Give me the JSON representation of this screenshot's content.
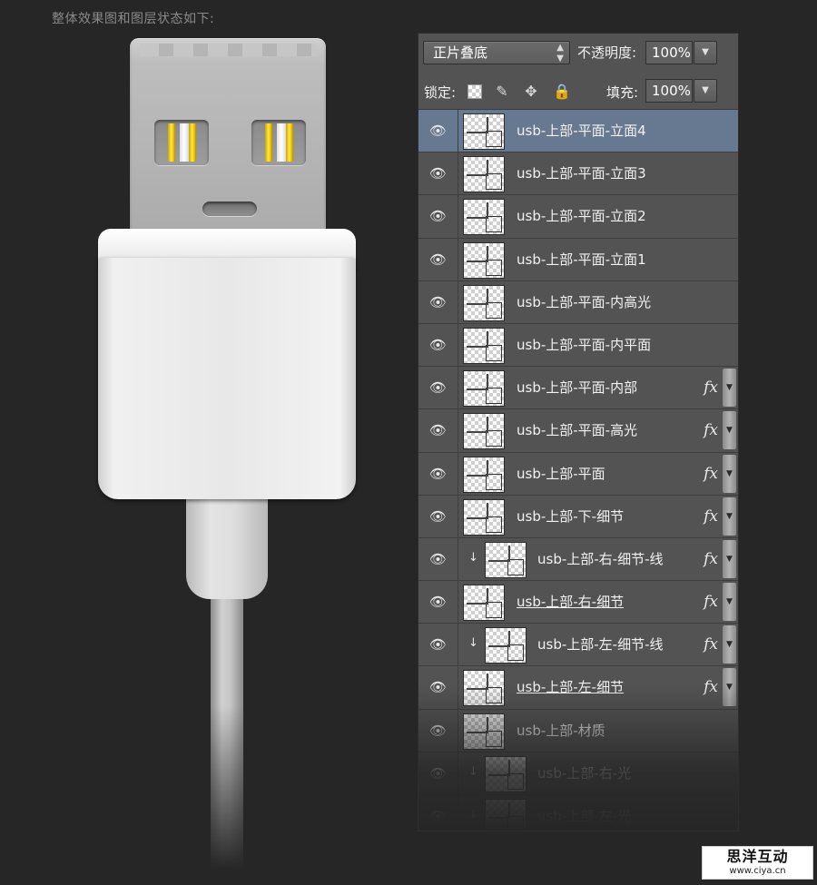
{
  "caption": "整体效果图和图层状态如下:",
  "panel": {
    "blend_mode": "正片叠底",
    "opacity_label": "不透明度:",
    "opacity_value": "100%",
    "lock_label": "锁定:",
    "fill_label": "填充:",
    "fill_value": "100%",
    "lock_icons": [
      "transparency-lock-icon",
      "brush-icon",
      "move-icon",
      "lock-icon"
    ]
  },
  "layers": [
    {
      "name": "usb-上部-平面-立面4",
      "selected": true,
      "fx": false,
      "clip": false,
      "underline": false
    },
    {
      "name": "usb-上部-平面-立面3",
      "selected": false,
      "fx": false,
      "clip": false,
      "underline": false
    },
    {
      "name": "usb-上部-平面-立面2",
      "selected": false,
      "fx": false,
      "clip": false,
      "underline": false
    },
    {
      "name": "usb-上部-平面-立面1",
      "selected": false,
      "fx": false,
      "clip": false,
      "underline": false
    },
    {
      "name": "usb-上部-平面-内高光",
      "selected": false,
      "fx": false,
      "clip": false,
      "underline": false
    },
    {
      "name": "usb-上部-平面-内平面",
      "selected": false,
      "fx": false,
      "clip": false,
      "underline": false
    },
    {
      "name": "usb-上部-平面-内部",
      "selected": false,
      "fx": true,
      "clip": false,
      "underline": false
    },
    {
      "name": "usb-上部-平面-高光",
      "selected": false,
      "fx": true,
      "clip": false,
      "underline": false
    },
    {
      "name": "usb-上部-平面",
      "selected": false,
      "fx": true,
      "clip": false,
      "underline": false
    },
    {
      "name": "usb-上部-下-细节",
      "selected": false,
      "fx": true,
      "clip": false,
      "underline": false
    },
    {
      "name": "usb-上部-右-细节-线",
      "selected": false,
      "fx": true,
      "clip": true,
      "underline": false
    },
    {
      "name": "usb-上部-右-细节",
      "selected": false,
      "fx": true,
      "clip": false,
      "underline": true
    },
    {
      "name": "usb-上部-左-细节-线",
      "selected": false,
      "fx": true,
      "clip": true,
      "underline": false
    },
    {
      "name": "usb-上部-左-细节",
      "selected": false,
      "fx": true,
      "clip": false,
      "underline": true
    },
    {
      "name": "usb-上部-材质",
      "selected": false,
      "fx": false,
      "clip": false,
      "underline": false
    },
    {
      "name": "usb-上部-右-光",
      "selected": false,
      "fx": false,
      "clip": true,
      "underline": false
    },
    {
      "name": "usb-上部-左-光",
      "selected": false,
      "fx": false,
      "clip": true,
      "underline": false
    }
  ],
  "watermark": {
    "title": "思洋互动",
    "url": "www.ciya.cn"
  }
}
